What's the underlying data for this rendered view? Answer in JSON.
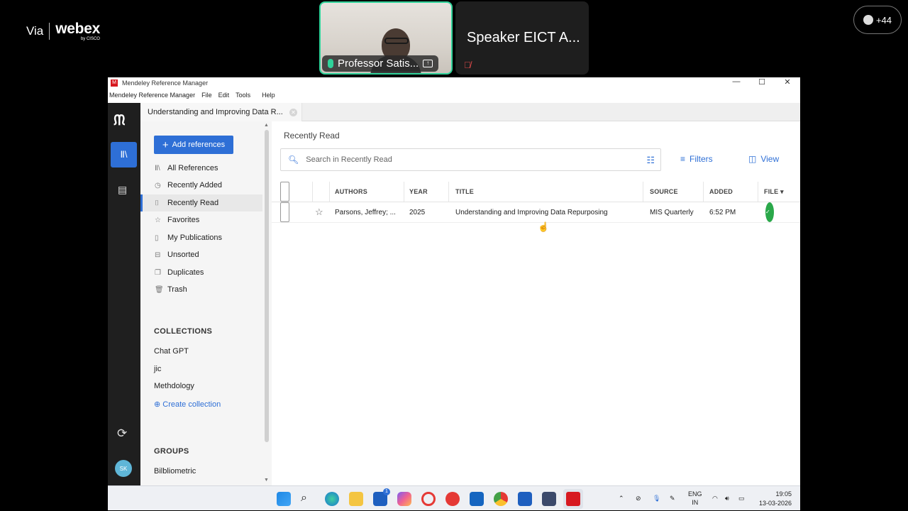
{
  "webex": {
    "via_label": "Via",
    "brand": "webex",
    "brand_sub": "by CISCO",
    "participants": [
      {
        "name": "Professor Satis...",
        "mic": "on"
      },
      {
        "name": "Speaker EICT A...",
        "mic": "muted"
      }
    ],
    "participant_count": "+44"
  },
  "window": {
    "title": "Mendeley Reference Manager",
    "controls": [
      "—",
      "☐",
      "✕"
    ],
    "menu": [
      "Mendeley Reference Manager",
      "File",
      "Edit",
      "Tools",
      "Help"
    ]
  },
  "tab": {
    "label": "Understanding and Improving Data R..."
  },
  "sidebar": {
    "add_button": "Add references",
    "items": [
      {
        "label": "All References",
        "icon": "library-icon"
      },
      {
        "label": "Recently Added",
        "icon": "clock-icon"
      },
      {
        "label": "Recently Read",
        "icon": "bookmark-icon"
      },
      {
        "label": "Favorites",
        "icon": "star-icon"
      },
      {
        "label": "My Publications",
        "icon": "document-icon"
      },
      {
        "label": "Unsorted",
        "icon": "tray-icon"
      },
      {
        "label": "Duplicates",
        "icon": "duplicate-icon"
      },
      {
        "label": "Trash",
        "icon": "trash-icon"
      }
    ],
    "active_item": "Recently Read",
    "collections_heading": "COLLECTIONS",
    "collections": [
      "Chat GPT",
      "jic",
      "Methdology"
    ],
    "create_collection": "Create collection",
    "groups_heading": "GROUPS",
    "groups": [
      "Bilbliometric"
    ]
  },
  "rail": {
    "avatar": "SK"
  },
  "main": {
    "page_title": "Recently Read",
    "search_placeholder": "Search in Recently Read",
    "filters_label": "Filters",
    "view_label": "View",
    "columns": [
      "AUTHORS",
      "YEAR",
      "TITLE",
      "SOURCE",
      "ADDED",
      "FILE ▾"
    ],
    "rows": [
      {
        "authors": "Parsons, Jeffrey; ...",
        "year": "2025",
        "title": "Understanding and Improving Data Repurposing",
        "source": "MIS Quarterly",
        "added": "6:52 PM",
        "file": "available"
      }
    ]
  },
  "taskbar": {
    "apps": [
      "windows-start",
      "search",
      "edge",
      "file-explorer",
      "store",
      "copilot",
      "opera",
      "acrobat",
      "outlook",
      "chrome",
      "word",
      "snipping",
      "mendeley"
    ],
    "store_badge": "1",
    "lang_top": "ENG",
    "lang_bottom": "IN",
    "time": "19:05",
    "date": "13-03-2026"
  },
  "colors": {
    "accent": "#2e6fd6",
    "rail_bg": "#1f1f1f",
    "speaker_border": "#2fd39a",
    "file_ok": "#2aa84a",
    "mendeley_red": "#d71920"
  }
}
